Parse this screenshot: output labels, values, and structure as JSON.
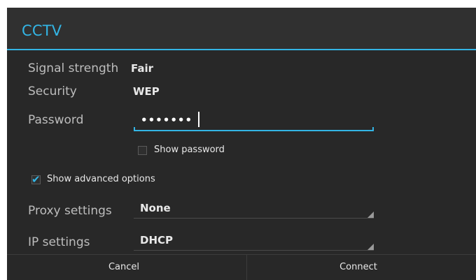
{
  "dialog": {
    "title": "CCTV",
    "accent_color": "#33b5e5",
    "rows": {
      "signal_strength": {
        "label": "Signal strength",
        "value": "Fair"
      },
      "security": {
        "label": "Security",
        "value": "WEP"
      },
      "password": {
        "label": "Password",
        "value": "•••••••"
      }
    },
    "show_password": {
      "label": "Show password",
      "checked": false
    },
    "show_advanced": {
      "label": "Show advanced options",
      "checked": true
    },
    "proxy": {
      "label": "Proxy settings",
      "value": "None"
    },
    "ip": {
      "label": "IP settings",
      "value": "DHCP"
    },
    "buttons": {
      "cancel": "Cancel",
      "connect": "Connect"
    }
  }
}
